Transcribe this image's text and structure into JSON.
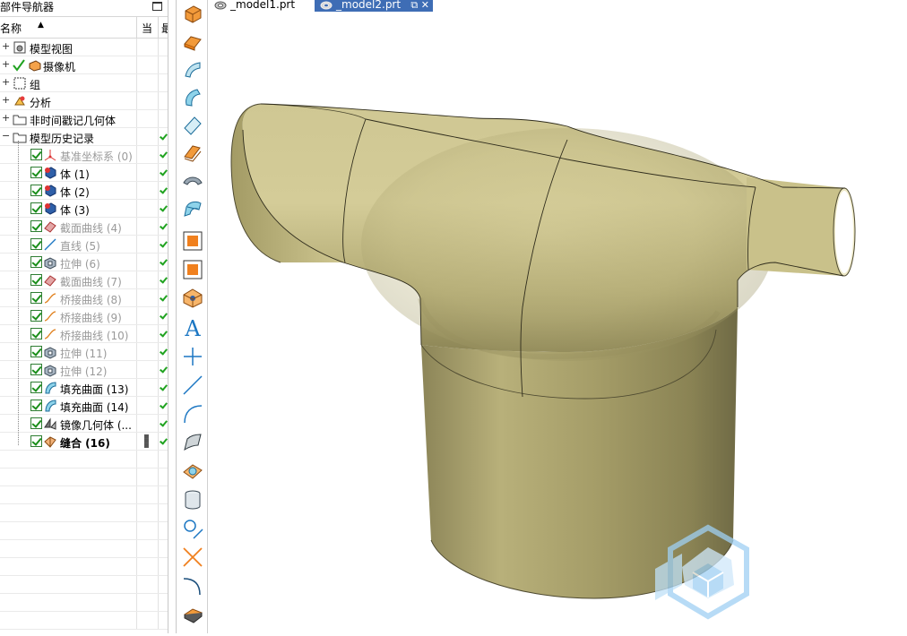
{
  "navigator": {
    "title": "部件导航器",
    "header": {
      "name_col": "名称",
      "current_col": "当",
      "extra_col": "最"
    },
    "items": [
      {
        "label": "模型视图",
        "grey": false,
        "bold": false
      },
      {
        "label": "摄像机",
        "grey": false,
        "bold": false
      },
      {
        "label": "组",
        "grey": false,
        "bold": false
      },
      {
        "label": "分析",
        "grey": false,
        "bold": false
      },
      {
        "label": "非时间戳记几何体",
        "grey": false,
        "bold": false
      },
      {
        "label": "模型历史记录",
        "grey": false,
        "bold": false
      },
      {
        "label": "基准坐标系 (0)",
        "grey": true,
        "bold": false
      },
      {
        "label": "体 (1)",
        "grey": false,
        "bold": false
      },
      {
        "label": "体 (2)",
        "grey": false,
        "bold": false
      },
      {
        "label": "体 (3)",
        "grey": false,
        "bold": false
      },
      {
        "label": "截面曲线 (4)",
        "grey": true,
        "bold": false
      },
      {
        "label": "直线 (5)",
        "grey": true,
        "bold": false
      },
      {
        "label": "拉伸 (6)",
        "grey": true,
        "bold": false
      },
      {
        "label": "截面曲线 (7)",
        "grey": true,
        "bold": false
      },
      {
        "label": "桥接曲线 (8)",
        "grey": true,
        "bold": false
      },
      {
        "label": "桥接曲线 (9)",
        "grey": true,
        "bold": false
      },
      {
        "label": "桥接曲线 (10)",
        "grey": true,
        "bold": false
      },
      {
        "label": "拉伸 (11)",
        "grey": true,
        "bold": false
      },
      {
        "label": "拉伸 (12)",
        "grey": true,
        "bold": false
      },
      {
        "label": "填充曲面 (13)",
        "grey": false,
        "bold": false
      },
      {
        "label": "填充曲面 (14)",
        "grey": false,
        "bold": false
      },
      {
        "label": "镜像几何体 (...",
        "grey": false,
        "bold": false
      },
      {
        "label": "缝合 (16)",
        "grey": false,
        "bold": true
      }
    ]
  },
  "tabs": [
    {
      "label": "_model1.prt",
      "active": false
    },
    {
      "label": "_model2.prt",
      "active": true
    }
  ],
  "colors": {
    "model_surface": "#c8c08a",
    "model_shadow": "#6f6a45",
    "active_tab": "#3e6db5",
    "check_green": "#1fa21f",
    "toolbar_orange": "#f0801e"
  }
}
